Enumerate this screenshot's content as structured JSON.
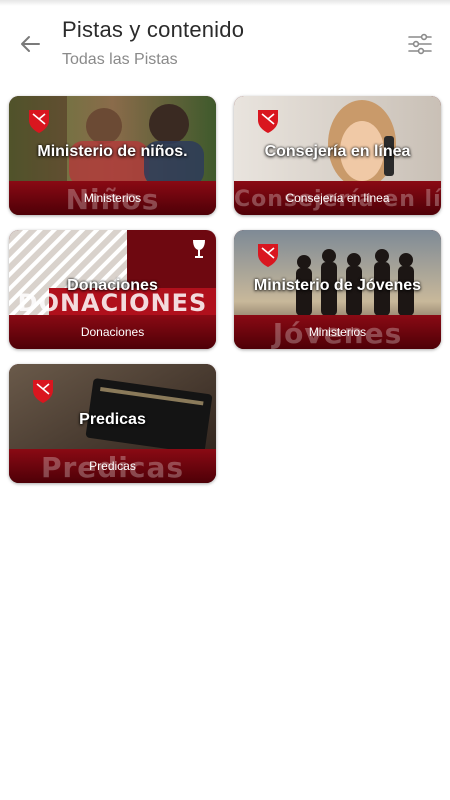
{
  "header": {
    "title": "Pistas y contenido",
    "subtitle": "Todas las Pistas",
    "back_icon": "arrow-left-icon",
    "filter_icon": "sliders-icon"
  },
  "cards": [
    {
      "title": "Ministerio de niños.",
      "category": "Ministerios",
      "band_word": "Niños"
    },
    {
      "title": "Consejería en línea",
      "category": "Consejería en línea",
      "band_word": "Consejería en línea"
    },
    {
      "title": "Donaciones",
      "category": "Donaciones",
      "band_word": "DONACIONES"
    },
    {
      "title": "Ministerio de Jóvenes",
      "category": "Ministerios",
      "band_word": "Jóvenes"
    },
    {
      "title": "Predicas",
      "category": "Predicas",
      "band_word": "Predicas"
    }
  ],
  "colors": {
    "accent_red": "#8a0a14",
    "dark_red": "#4e0007",
    "logo_red": "#d9161f"
  }
}
